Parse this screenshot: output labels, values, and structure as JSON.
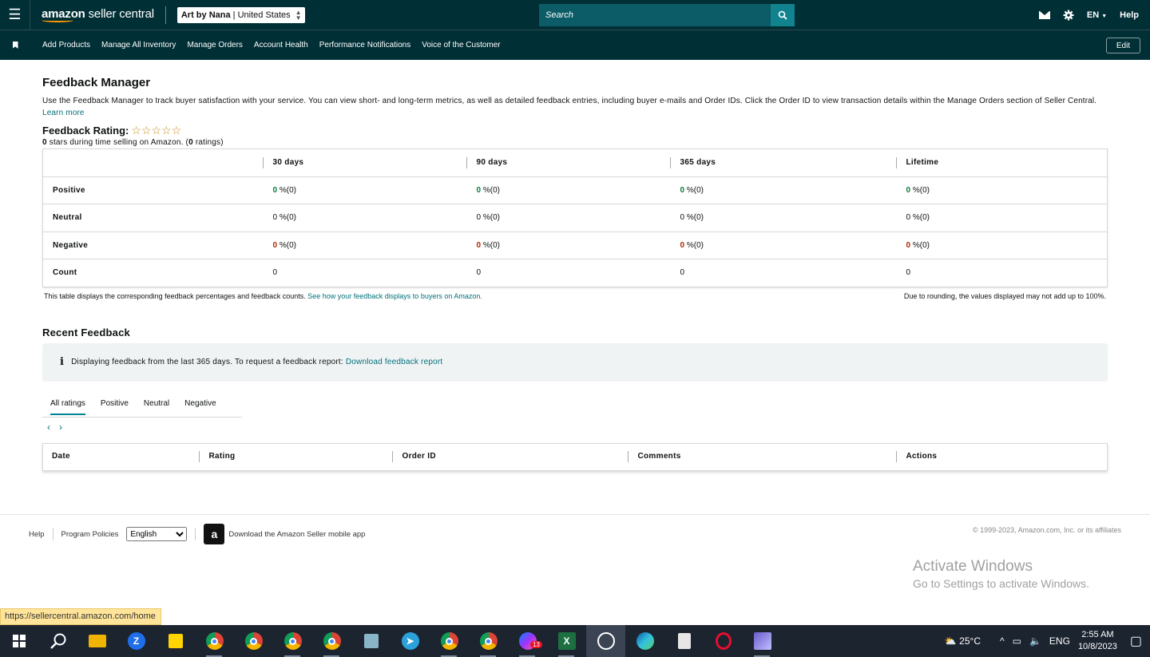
{
  "header": {
    "logo_brand": "amazon",
    "logo_sub": "seller central",
    "account": "Art by Nana",
    "marketplace": "United States",
    "search_placeholder": "Search",
    "language": "EN",
    "help": "Help"
  },
  "nav": {
    "items": [
      "Add Products",
      "Manage All Inventory",
      "Manage Orders",
      "Account Health",
      "Performance Notifications",
      "Voice of the Customer"
    ],
    "edit": "Edit"
  },
  "page": {
    "title": "Feedback Manager",
    "description": "Use the Feedback Manager to track buyer satisfaction with your service. You can view short- and long-term metrics, as well as detailed feedback entries, including buyer e-mails and Order IDs. Click the Order ID to view transaction details within the Manage Orders section of Seller Central.",
    "learn_more": "Learn more",
    "rating_label": "Feedback Rating:",
    "stars": "☆☆☆☆☆",
    "rating_value": "0",
    "rating_text_a": " stars during time selling on Amazon. (",
    "rating_count": "0",
    "rating_text_b": " ratings)"
  },
  "feedback_table": {
    "columns": [
      "30 days",
      "90 days",
      "365 days",
      "Lifetime"
    ],
    "rows": [
      {
        "label": "Positive",
        "values": [
          "0",
          "0",
          "0",
          "0"
        ],
        "suffix": "%(0)"
      },
      {
        "label": "Neutral",
        "values": [
          "0",
          "0",
          "0",
          "0"
        ],
        "suffix": "%(0)"
      },
      {
        "label": "Negative",
        "values": [
          "0",
          "0",
          "0",
          "0"
        ],
        "suffix": "%(0)"
      },
      {
        "label": "Count",
        "values": [
          "0",
          "0",
          "0",
          "0"
        ]
      }
    ],
    "note_left": "This table displays the corresponding feedback percentages and feedback counts.",
    "note_link": "See how your feedback displays to buyers on Amazon.",
    "note_right": "Due to rounding, the values displayed may not add up to 100%."
  },
  "recent": {
    "title": "Recent Feedback",
    "info_text": "Displaying feedback from the last 365 days. To request a feedback report:",
    "info_link": "Download feedback report",
    "tabs": [
      "All ratings",
      "Positive",
      "Neutral",
      "Negative"
    ],
    "columns": [
      "Date",
      "Rating",
      "Order ID",
      "Comments",
      "Actions"
    ]
  },
  "footer": {
    "help": "Help",
    "policies": "Program Policies",
    "language": "English",
    "app_text": "Download the Amazon Seller mobile app",
    "copyright": "© 1999-2023, Amazon.com, Inc. or its affiliates"
  },
  "watermark": {
    "line1": "Activate Windows",
    "line2": "Go to Settings to activate Windows."
  },
  "status_url": "https://sellercentral.amazon.com/home",
  "taskbar": {
    "weather": "25°C",
    "lang": "ENG",
    "time": "2:55 AM",
    "date": "10/8/2023",
    "badge": "13"
  },
  "colors": {
    "header_bg": "#002f36",
    "accent": "#008296",
    "positive": "#067d3a",
    "negative": "#b12704"
  }
}
